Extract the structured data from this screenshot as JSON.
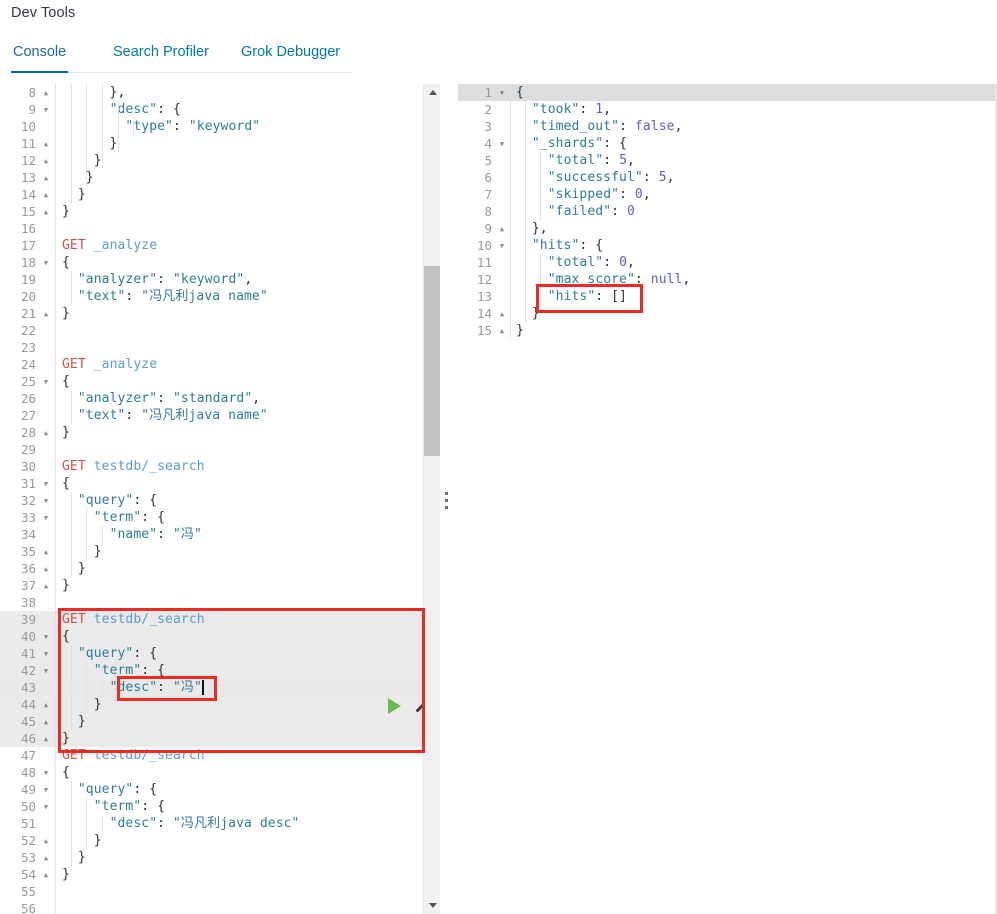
{
  "header": {
    "title": "Dev Tools",
    "tabs": [
      {
        "label": "Console",
        "active": true
      },
      {
        "label": "Search Profiler",
        "active": false
      },
      {
        "label": "Grok Debugger",
        "active": false
      }
    ]
  },
  "icons": {
    "play": "play-icon",
    "wrench": "wrench-icon",
    "scroll_up": "chevron-up-icon",
    "scroll_down": "chevron-down-icon",
    "drag": "drag-handle-icon"
  },
  "colors": {
    "accent": "#0b6898",
    "tab_link": "#0079a5",
    "method": "#d0514c",
    "url": "#5a9ecb",
    "string": "#2f7b99",
    "number": "#5c5cd6",
    "play_green": "#68bc4e",
    "annotation_red": "#ee2a24",
    "active_line": "#e8e8e8"
  },
  "editor": {
    "name": "console-request-editor",
    "first_line": 8,
    "last_line": 56,
    "active_line": 43,
    "caret_line": 43,
    "lines": [
      {
        "n": 8,
        "fold": "up",
        "indent": 3,
        "text": "      },"
      },
      {
        "n": 9,
        "fold": "down",
        "indent": 4,
        "text": "      \"desc\": {"
      },
      {
        "n": 10,
        "fold": "",
        "indent": 5,
        "text": "        \"type\": \"keyword\""
      },
      {
        "n": 11,
        "fold": "up",
        "indent": 4,
        "text": "      }"
      },
      {
        "n": 12,
        "fold": "up",
        "indent": 3,
        "text": "    }"
      },
      {
        "n": 13,
        "fold": "up",
        "indent": 2,
        "text": "   }"
      },
      {
        "n": 14,
        "fold": "up",
        "indent": 1,
        "text": "  }"
      },
      {
        "n": 15,
        "fold": "up",
        "indent": 0,
        "text": "}"
      },
      {
        "n": 16,
        "fold": "",
        "indent": 0,
        "text": ""
      },
      {
        "n": 17,
        "fold": "",
        "indent": 0,
        "text": "GET _analyze",
        "kind": "request"
      },
      {
        "n": 18,
        "fold": "down",
        "indent": 0,
        "text": "{"
      },
      {
        "n": 19,
        "fold": "",
        "indent": 1,
        "text": "  \"analyzer\": \"keyword\","
      },
      {
        "n": 20,
        "fold": "",
        "indent": 1,
        "text": "  \"text\": \"冯凡利java name\""
      },
      {
        "n": 21,
        "fold": "up",
        "indent": 0,
        "text": "}"
      },
      {
        "n": 22,
        "fold": "",
        "indent": 0,
        "text": ""
      },
      {
        "n": 23,
        "fold": "",
        "indent": 0,
        "text": ""
      },
      {
        "n": 24,
        "fold": "",
        "indent": 0,
        "text": "GET _analyze",
        "kind": "request"
      },
      {
        "n": 25,
        "fold": "down",
        "indent": 0,
        "text": "{"
      },
      {
        "n": 26,
        "fold": "",
        "indent": 1,
        "text": "  \"analyzer\": \"standard\","
      },
      {
        "n": 27,
        "fold": "",
        "indent": 1,
        "text": "  \"text\": \"冯凡利java name\""
      },
      {
        "n": 28,
        "fold": "up",
        "indent": 0,
        "text": "}"
      },
      {
        "n": 29,
        "fold": "",
        "indent": 0,
        "text": ""
      },
      {
        "n": 30,
        "fold": "",
        "indent": 0,
        "text": "GET testdb/_search",
        "kind": "request"
      },
      {
        "n": 31,
        "fold": "down",
        "indent": 0,
        "text": "{"
      },
      {
        "n": 32,
        "fold": "down",
        "indent": 1,
        "text": "  \"query\": {"
      },
      {
        "n": 33,
        "fold": "down",
        "indent": 2,
        "text": "    \"term\": {"
      },
      {
        "n": 34,
        "fold": "",
        "indent": 3,
        "text": "      \"name\": \"冯\""
      },
      {
        "n": 35,
        "fold": "up",
        "indent": 2,
        "text": "    }"
      },
      {
        "n": 36,
        "fold": "up",
        "indent": 1,
        "text": "  }"
      },
      {
        "n": 37,
        "fold": "up",
        "indent": 0,
        "text": "}"
      },
      {
        "n": 38,
        "fold": "",
        "indent": 0,
        "text": ""
      },
      {
        "n": 39,
        "fold": "",
        "indent": 0,
        "text": "GET testdb/_search",
        "kind": "request",
        "sel": true
      },
      {
        "n": 40,
        "fold": "down",
        "indent": 0,
        "text": "{",
        "sel": true
      },
      {
        "n": 41,
        "fold": "down",
        "indent": 1,
        "text": "  \"query\": {",
        "sel": true
      },
      {
        "n": 42,
        "fold": "down",
        "indent": 2,
        "text": "    \"term\": {",
        "sel": true
      },
      {
        "n": 43,
        "fold": "",
        "indent": 3,
        "text": "      \"desc\": \"冯\"",
        "sel": true,
        "active": true
      },
      {
        "n": 44,
        "fold": "up",
        "indent": 2,
        "text": "    }",
        "sel": true
      },
      {
        "n": 45,
        "fold": "up",
        "indent": 1,
        "text": "  }",
        "sel": true
      },
      {
        "n": 46,
        "fold": "up",
        "indent": 0,
        "text": "}",
        "sel": true
      },
      {
        "n": 47,
        "fold": "",
        "indent": 0,
        "text": "GET testdb/_search",
        "kind": "request"
      },
      {
        "n": 48,
        "fold": "down",
        "indent": 0,
        "text": "{"
      },
      {
        "n": 49,
        "fold": "down",
        "indent": 1,
        "text": "  \"query\": {"
      },
      {
        "n": 50,
        "fold": "down",
        "indent": 2,
        "text": "    \"term\": {"
      },
      {
        "n": 51,
        "fold": "",
        "indent": 3,
        "text": "      \"desc\": \"冯凡利java desc\""
      },
      {
        "n": 52,
        "fold": "up",
        "indent": 2,
        "text": "    }"
      },
      {
        "n": 53,
        "fold": "up",
        "indent": 1,
        "text": "  }"
      },
      {
        "n": 54,
        "fold": "up",
        "indent": 0,
        "text": "}"
      },
      {
        "n": 55,
        "fold": "",
        "indent": 0,
        "text": ""
      },
      {
        "n": 56,
        "fold": "",
        "indent": 0,
        "text": ""
      }
    ]
  },
  "response": {
    "name": "console-response-viewer",
    "active_line": 1,
    "lines": [
      {
        "n": 1,
        "fold": "down",
        "indent": 0,
        "text": "{",
        "active": true
      },
      {
        "n": 2,
        "fold": "",
        "indent": 1,
        "text": "  \"took\": 1,"
      },
      {
        "n": 3,
        "fold": "",
        "indent": 1,
        "text": "  \"timed_out\": false,"
      },
      {
        "n": 4,
        "fold": "down",
        "indent": 1,
        "text": "  \"_shards\": {"
      },
      {
        "n": 5,
        "fold": "",
        "indent": 2,
        "text": "    \"total\": 5,"
      },
      {
        "n": 6,
        "fold": "",
        "indent": 2,
        "text": "    \"successful\": 5,"
      },
      {
        "n": 7,
        "fold": "",
        "indent": 2,
        "text": "    \"skipped\": 0,"
      },
      {
        "n": 8,
        "fold": "",
        "indent": 2,
        "text": "    \"failed\": 0"
      },
      {
        "n": 9,
        "fold": "up",
        "indent": 1,
        "text": "  },"
      },
      {
        "n": 10,
        "fold": "down",
        "indent": 1,
        "text": "  \"hits\": {"
      },
      {
        "n": 11,
        "fold": "",
        "indent": 2,
        "text": "    \"total\": 0,"
      },
      {
        "n": 12,
        "fold": "",
        "indent": 2,
        "text": "    \"max_score\": null,"
      },
      {
        "n": 13,
        "fold": "",
        "indent": 2,
        "text": "    \"hits\": []"
      },
      {
        "n": 14,
        "fold": "up",
        "indent": 1,
        "text": "  }"
      },
      {
        "n": 15,
        "fold": "up",
        "indent": 0,
        "text": "}"
      }
    ],
    "json": {
      "took": 1,
      "timed_out": false,
      "_shards": {
        "total": 5,
        "successful": 5,
        "skipped": 0,
        "failed": 0
      },
      "hits": {
        "total": 0,
        "max_score": null,
        "hits": []
      }
    }
  },
  "annotations": [
    {
      "name": "highlighted-request-block",
      "lines": "39-46"
    },
    {
      "name": "highlighted-desc-term",
      "text": "\"desc\": \"冯\""
    },
    {
      "name": "highlighted-empty-hits",
      "text": "\"hits\": []"
    }
  ]
}
